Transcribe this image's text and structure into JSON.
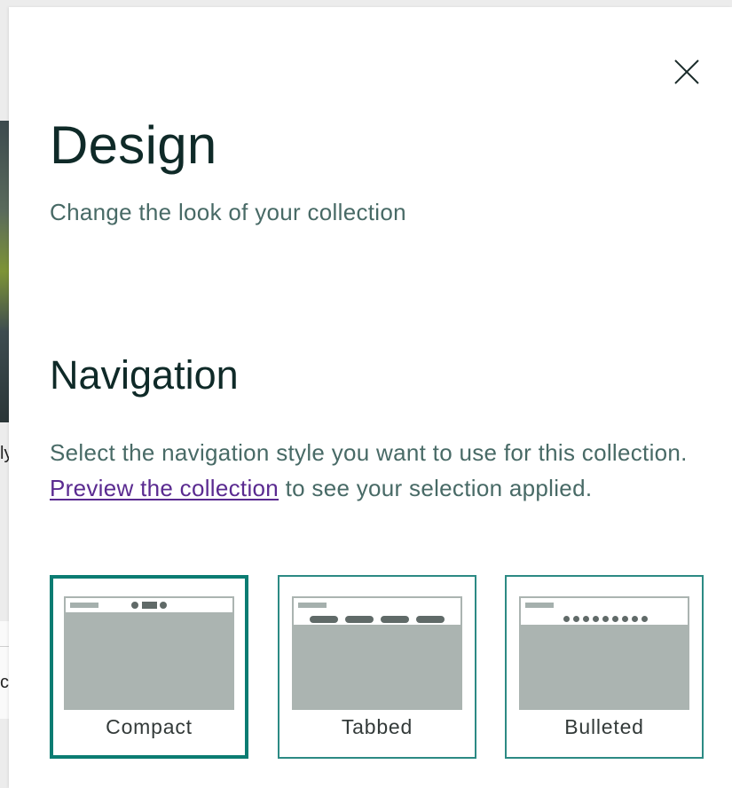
{
  "background": {
    "fragment_a": "ly",
    "fragment_b": "c"
  },
  "panel": {
    "close_icon": "close-icon",
    "title": "Design",
    "subtitle": "Change the look of your collection",
    "navigation": {
      "heading": "Navigation",
      "desc_before": "Select the navigation style you want to use for this collection. ",
      "preview_link": "Preview the collection",
      "desc_after": " to see your selection applied.",
      "options": [
        {
          "label": "Compact",
          "selected": true
        },
        {
          "label": "Tabbed",
          "selected": false
        },
        {
          "label": "Bulleted",
          "selected": false
        }
      ]
    }
  },
  "colors": {
    "accent": "#0b7c72",
    "link": "#5a2a90",
    "title": "#0f2a28",
    "body_text": "#486a66",
    "thumb_fill": "#abb4b1"
  }
}
